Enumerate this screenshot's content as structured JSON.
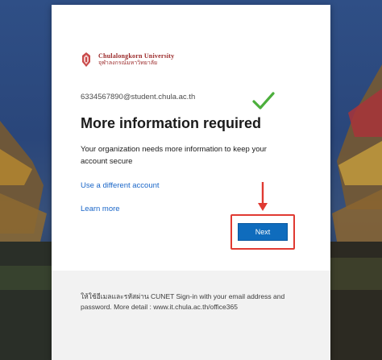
{
  "university": {
    "name_en": "Chulalongkorn University",
    "name_th": "จุฬาลงกรณ์มหาวิทยาลัย"
  },
  "identity": {
    "email": "6334567890@student.chula.ac.th"
  },
  "dialog": {
    "title": "More information required",
    "body": "Your organization needs more information to keep your account secure",
    "use_different_account": "Use a different account",
    "learn_more": "Learn more",
    "next_button": "Next"
  },
  "footer": {
    "text": "ให้ใช้อีเมลและรหัสผ่าน CUNET Sign-in with your email address and password. More detail : www.it.chula.ac.th/office365"
  },
  "colors": {
    "accent": "#0f6cbd",
    "link": "#1a66c8",
    "annotation": "#e03a32",
    "check": "#4caf3c",
    "brand": "#9b2a2a"
  },
  "icons": {
    "logo": "chula-crest-icon",
    "checkmark": "checkmark-icon",
    "arrow": "arrow-down-icon"
  }
}
